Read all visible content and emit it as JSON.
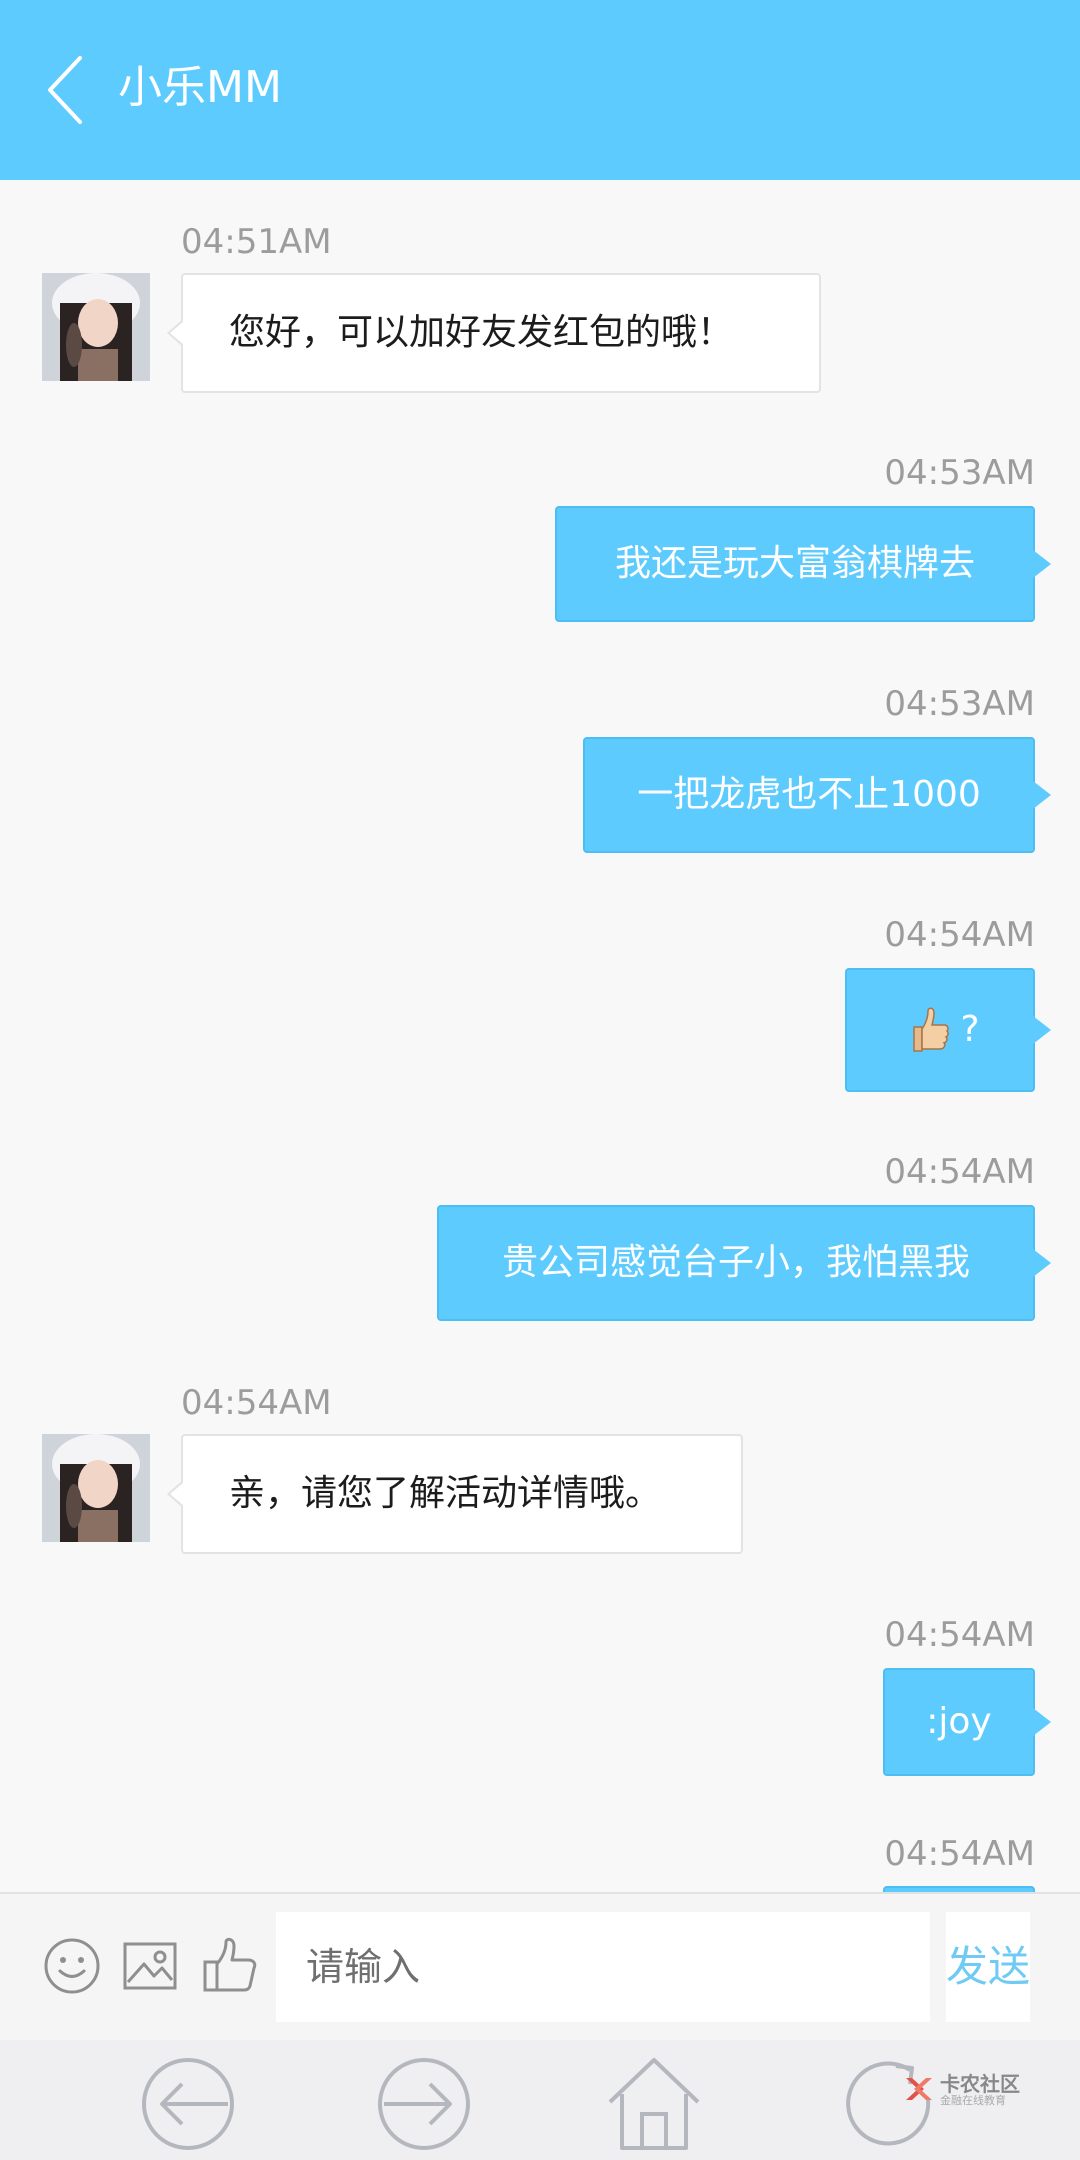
{
  "header": {
    "title": "小乐MM",
    "back_icon": "chevron-left-icon"
  },
  "messages": [
    {
      "side": "in",
      "time": "04:51AM",
      "text": "您好，可以加好友发红包的哦！"
    },
    {
      "side": "out",
      "time": "04:53AM",
      "text": "我还是玩大富翁棋牌去"
    },
    {
      "side": "out",
      "time": "04:53AM",
      "text": "一把龙虎也不止1000"
    },
    {
      "side": "out",
      "time": "04:54AM",
      "text": "?",
      "emoji": "thumbs-up-emoji"
    },
    {
      "side": "out",
      "time": "04:54AM",
      "text": "贵公司感觉台子小，我怕黑我"
    },
    {
      "side": "in",
      "time": "04:54AM",
      "text": "亲，请您了解活动详情哦。"
    },
    {
      "side": "out",
      "time": "04:54AM",
      "text": ":joy"
    },
    {
      "side": "out",
      "time": "04:54AM",
      "text": ""
    }
  ],
  "input_bar": {
    "placeholder": "请输入",
    "send_label": "发送",
    "icons": [
      "smiley-icon",
      "image-icon",
      "thumbs-up-icon"
    ]
  },
  "nav_bar": {
    "icons": [
      "back-arrow-icon",
      "forward-arrow-icon",
      "home-icon",
      "refresh-icon"
    ]
  },
  "watermark": {
    "brand": "卡农社区",
    "subtitle": "金融在线教育"
  },
  "colors": {
    "accent": "#5ecbff",
    "send_text": "#6fcaf4",
    "timestamp": "#9c9c9c"
  }
}
